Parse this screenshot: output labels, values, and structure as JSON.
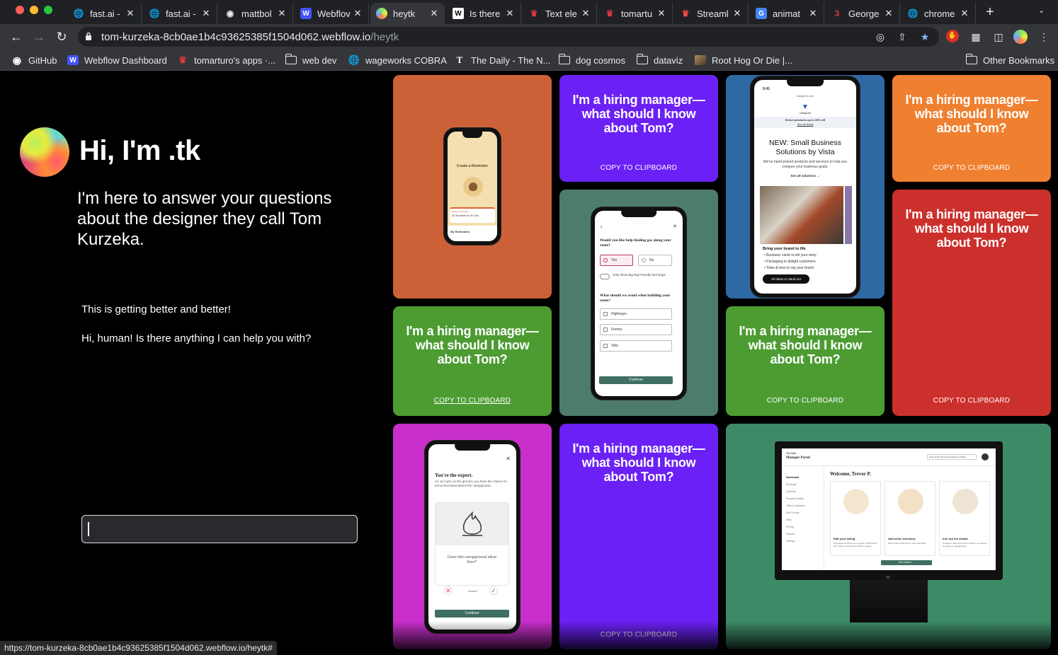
{
  "browser": {
    "tabs": [
      {
        "title": "fast.ai -",
        "icon": "globe-icon",
        "color": "#e8eaed"
      },
      {
        "title": "fast.ai -",
        "icon": "globe-icon",
        "color": "#e8eaed"
      },
      {
        "title": "mattbol",
        "icon": "github-icon",
        "color": "#e8eaed"
      },
      {
        "title": "Webflov",
        "icon": "webflow-icon",
        "color": "#4353ff"
      },
      {
        "title": "heytk",
        "icon": "heytk-orb-icon",
        "color": "#b6f05a"
      },
      {
        "title": "Is there",
        "icon": "wikipedia-icon",
        "color": "#ffffff"
      },
      {
        "title": "Text ele",
        "icon": "crown-icon",
        "color": "#e0383e"
      },
      {
        "title": "tomartu",
        "icon": "crown-icon",
        "color": "#e0383e"
      },
      {
        "title": "Streaml",
        "icon": "streamlit-crown-icon",
        "color": "#ff4b4b"
      },
      {
        "title": "animat",
        "icon": "google-icon",
        "color": "#4285f4"
      },
      {
        "title": "George",
        "icon": "george-icon",
        "color": "#e0383e"
      },
      {
        "title": "chrome",
        "icon": "globe-icon",
        "color": "#e8eaed"
      }
    ],
    "active_tab_index": 4,
    "url_host": "tom-kurzeka-8cb0ae1b4c93625385f1504d062.webflow.io",
    "url_path": "/heytk",
    "bookmarks": [
      {
        "label": "GitHub",
        "icon": "github-icon"
      },
      {
        "label": "Webflow Dashboard",
        "icon": "webflow-icon"
      },
      {
        "label": "tomarturo's apps ·...",
        "icon": "crown-icon"
      },
      {
        "label": "web dev",
        "icon": "folder-icon"
      },
      {
        "label": "wageworks COBRA",
        "icon": "globe-icon"
      },
      {
        "label": "The Daily - The N...",
        "icon": "nyt-icon"
      },
      {
        "label": "dog cosmos",
        "icon": "folder-icon"
      },
      {
        "label": "dataviz",
        "icon": "folder-icon"
      },
      {
        "label": "Root Hog Or Die |...",
        "icon": "image-icon"
      }
    ],
    "other_bookmarks": "Other Bookmarks",
    "status_url": "https://tom-kurzeka-8cb0ae1b4c93625385f1504d062.webflow.io/heytk#"
  },
  "hero": {
    "greeting": "Hi, I'm .tk",
    "intro": "I'm here to answer your questions about the designer they call Tom Kurzeka."
  },
  "chat": {
    "messages": [
      "This is getting better and better!",
      "Hi, human! Is there anything I can help you with?"
    ],
    "input_value": ""
  },
  "cards": {
    "question": "I'm a hiring manager— what should I know about Tom?",
    "copy_label": "COPY TO CLIPBOARD",
    "colors": {
      "orange_dark": "#cc6138",
      "purple": "#6b21f5",
      "blue": "#2f69a4",
      "orange": "#ef8030",
      "teal": "#4d7c6b",
      "green": "#4c9c32",
      "red": "#cc302c",
      "magenta": "#c82fcb",
      "green_dark": "#3d8a66"
    }
  },
  "phones": {
    "reminder": {
      "title": "Create a Reminder",
      "footer": "My Reminders",
      "note1": "20 Sunsets in 30 Chs",
      "note2": "Hosting Reminder"
    },
    "route": {
      "q1": "Would you like help finding gas along your route?",
      "yes": "Yes",
      "no": "No",
      "toggle": "Only show Big-Rig Friendly fuel stops",
      "q2": "What should we avoid when building your route?",
      "opts": [
        "Highways",
        "Ferries",
        "Tolls"
      ],
      "cta": "Continue"
    },
    "vista": {
      "time": "9:41",
      "domain": "vistaprint.com",
      "brand": "vistaprint",
      "promo": "Select products up to 30% off",
      "promo_link": "See all deals",
      "headline": "NEW: Small Business Solutions by Vista",
      "body": "We've hand-picked products and services to help you conquer your business goals.",
      "link": "See all solutions →",
      "list_title": "Bring your brand to life",
      "bullets": [
        "Business cards to tell your story",
        "Packaging to delight customers",
        "Totes & tees to rep your brand"
      ],
      "cta": "23 ideas to stand out"
    },
    "campground": {
      "title": "You're the expert.",
      "body": "As our eyes on the ground, you have the chance to tell us first hand about this campground.",
      "question": "Does this campground allow fires?",
      "unsure": "Unsure",
      "cta": "Continue"
    }
  },
  "desktop": {
    "brand": "The Dyrt",
    "portal": "Manager Portal",
    "selector": "Cove of the Sounds Camping & Cabins",
    "welcome": "Welcome, Trevor P.",
    "nav": [
      "Dashboard",
      "Bookings",
      "Calendar",
      "Property Details",
      "Offers & Updates",
      "Site Groups",
      "Sites",
      "Pricing",
      "Payouts",
      "Settings"
    ],
    "tiles": [
      {
        "title": "Edit your listing",
        "body": "Tell guests all about your property. Add photos and videos so they know what to expect."
      },
      {
        "title": "Add some inventory",
        "body": "First create a Site Group, then add Sites."
      },
      {
        "title": "Iron out the details",
        "body": "Configure rates and enroll in Stripe, our partner for revenue management."
      }
    ],
    "cta": "Get Started →"
  }
}
